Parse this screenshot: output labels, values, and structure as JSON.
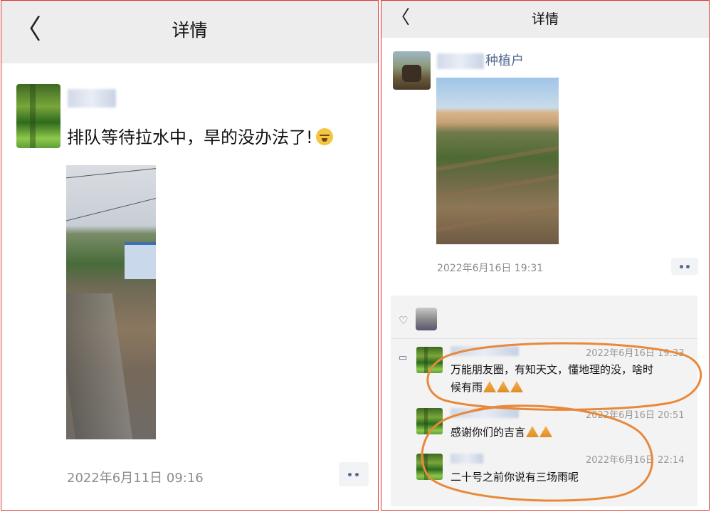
{
  "left_screen": {
    "header": {
      "back_glyph": "〈",
      "title": "详情"
    },
    "post": {
      "author": "",
      "text": "排队等待拉水中，旱的没办法了!",
      "timestamp": "2022年6月11日 09:16"
    }
  },
  "right_screen": {
    "header": {
      "back_glyph": "〈",
      "title": "详情"
    },
    "post": {
      "author": "种植户",
      "timestamp": "2022年6月16日 19:31"
    },
    "comments": [
      {
        "author": "",
        "time": "2022年6月16日 19:33",
        "text": "万能朋友圈，有知天文，懂地理的没，啥时",
        "text2": "候有雨"
      },
      {
        "author": "",
        "time": "2022年6月16日 20:51",
        "text": "感谢你们的吉言"
      },
      {
        "author": "",
        "time": "2022年6月16日 22:14",
        "text": "二十号之前你说有三场雨呢"
      }
    ]
  },
  "colors": {
    "annotation_orange": "#e8883a",
    "link_blue": "#576b95",
    "panel_border": "#d9342b"
  },
  "icons": [
    "back-chevron-icon",
    "face-emoji-icon",
    "more-dots-icon",
    "heart-icon",
    "comment-icon",
    "pray-hands-icon"
  ]
}
